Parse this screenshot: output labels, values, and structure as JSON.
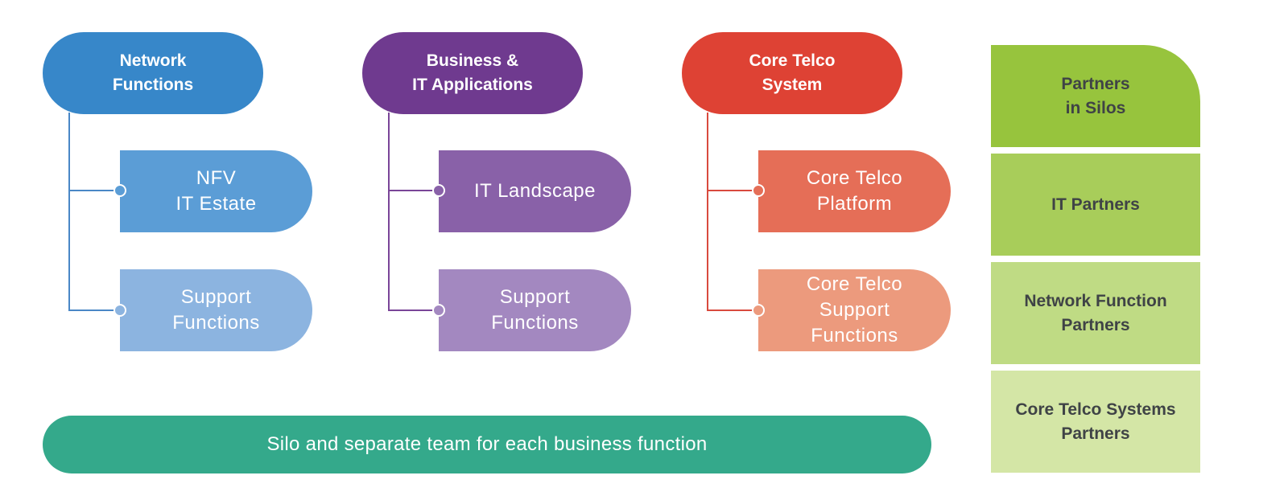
{
  "columns": [
    {
      "title": "Network Functions",
      "title_lines": "Network\nFunctions",
      "color": "#3787c9",
      "line_color": "#4a87c6",
      "children": [
        {
          "label": "NFV\nIT Estate",
          "color": "#5b9dd6"
        },
        {
          "label": "Support\nFunctions",
          "color": "#8cb4e0"
        }
      ]
    },
    {
      "title": "Business & IT Applications",
      "title_lines": "Business &\nIT Applications",
      "color": "#6f3a8f",
      "line_color": "#7a4598",
      "children": [
        {
          "label": "IT Landscape",
          "color": "#8961a8"
        },
        {
          "label": "Support\nFunctions",
          "color": "#a388c0"
        }
      ]
    },
    {
      "title": "Core Telco System",
      "title_lines": "Core Telco\nSystem",
      "color": "#de4234",
      "line_color": "#d94a3e",
      "children": [
        {
          "label": "Core Telco\nPlatform",
          "color": "#e56e57"
        },
        {
          "label": "Core Telco\nSupport\nFunctions",
          "color": "#ec9a7d"
        }
      ]
    }
  ],
  "partners": {
    "title": "Partners\nin Silos",
    "items": [
      {
        "label": "Partners\nin Silos",
        "color": "#97c43d"
      },
      {
        "label": "IT Partners",
        "color": "#a8cd5a"
      },
      {
        "label": "Network Function\nPartners",
        "color": "#bfdb84"
      },
      {
        "label": "Core Telco Systems\nPartners",
        "color": "#d4e6a6"
      }
    ]
  },
  "footer": {
    "label": "Silo and separate team for each business function",
    "color": "#34a98b"
  }
}
